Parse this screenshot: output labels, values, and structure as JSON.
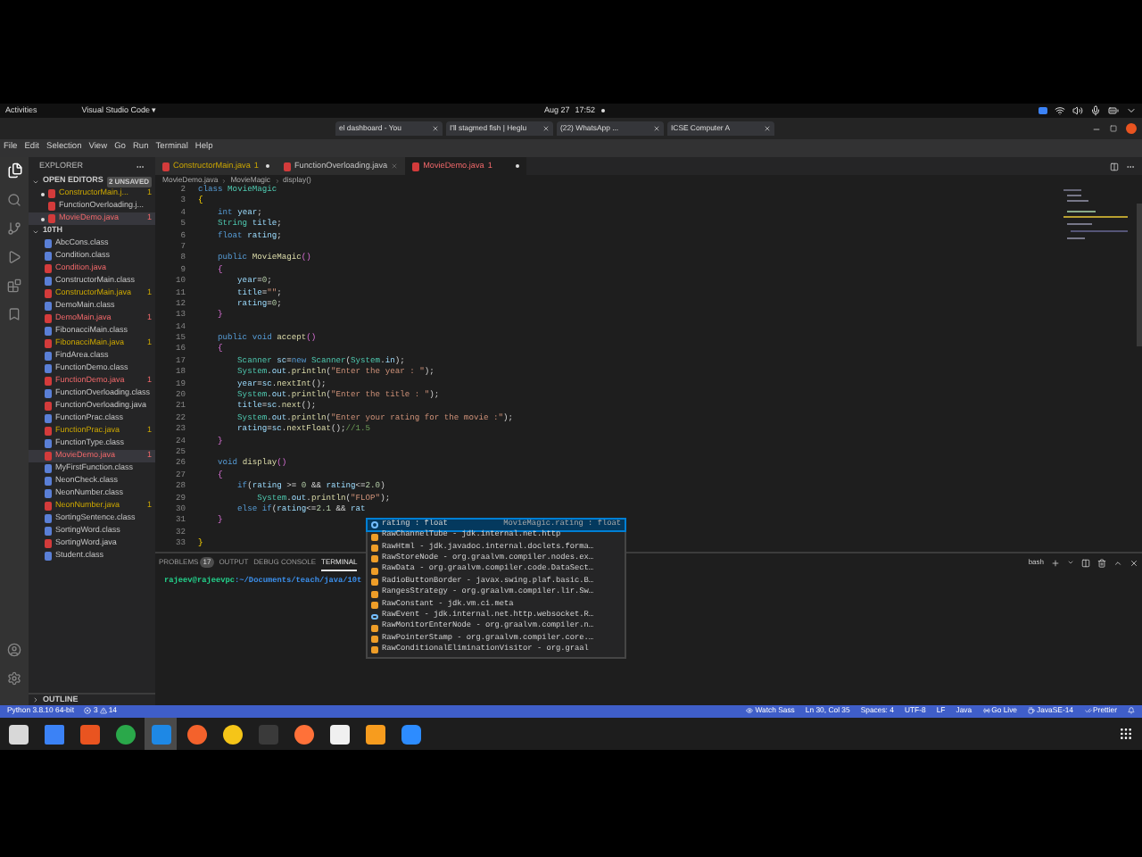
{
  "top_bar": {
    "activities": "Activities",
    "app_menu": "Visual Studio Code ▾",
    "date": "Aug 27",
    "time": "17:52"
  },
  "browser_tabs": [
    {
      "title": "el dashboard - You"
    },
    {
      "title": "I'll stagmed fish | Heglu"
    },
    {
      "title": "(22) WhatsApp ..."
    },
    {
      "title": "ICSE Computer A"
    }
  ],
  "menu": [
    "File",
    "Edit",
    "Selection",
    "View",
    "Go",
    "Run",
    "Terminal",
    "Help"
  ],
  "explorer": {
    "title": "EXPLORER",
    "open_editors": {
      "title": "OPEN EDITORS",
      "badge": "2 UNSAVED",
      "items": [
        {
          "name": "ConstructorMain.j...",
          "kind": "java",
          "warning": true,
          "error": false,
          "badge": "1",
          "modified": true,
          "selected": false
        },
        {
          "name": "FunctionOverloading.j...",
          "kind": "java",
          "warning": false,
          "error": false,
          "modified": false,
          "selected": false
        },
        {
          "name": "MovieDemo.java",
          "kind": "java",
          "warning": false,
          "error": true,
          "badge": "1",
          "modified": true,
          "selected": true
        }
      ]
    },
    "folder": {
      "name": "10TH",
      "expanded": true,
      "files": [
        {
          "name": "AbcCons.class",
          "kind": "class",
          "warning": false,
          "error": false,
          "selected": false
        },
        {
          "name": "Condition.class",
          "kind": "class",
          "warning": false,
          "error": false,
          "selected": false
        },
        {
          "name": "Condition.java",
          "kind": "java",
          "warning": false,
          "error": true,
          "selected": false
        },
        {
          "name": "ConstructorMain.class",
          "kind": "class",
          "warning": false,
          "error": false,
          "selected": false
        },
        {
          "name": "ConstructorMain.java",
          "kind": "java",
          "warning": true,
          "error": false,
          "badge": "1",
          "selected": false
        },
        {
          "name": "DemoMain.class",
          "kind": "class",
          "warning": false,
          "error": false,
          "selected": false
        },
        {
          "name": "DemoMain.java",
          "kind": "java",
          "warning": false,
          "error": true,
          "badge": "1",
          "selected": false
        },
        {
          "name": "FibonacciMain.class",
          "kind": "class",
          "warning": false,
          "error": false,
          "selected": false
        },
        {
          "name": "FibonacciMain.java",
          "kind": "java",
          "warning": true,
          "error": false,
          "badge": "1",
          "selected": false
        },
        {
          "name": "FindArea.class",
          "kind": "class",
          "warning": false,
          "error": false,
          "selected": false
        },
        {
          "name": "FunctionDemo.class",
          "kind": "class",
          "warning": false,
          "error": false,
          "selected": false
        },
        {
          "name": "FunctionDemo.java",
          "kind": "java",
          "warning": false,
          "error": true,
          "badge": "1",
          "selected": false
        },
        {
          "name": "FunctionOverloading.class",
          "kind": "class",
          "warning": false,
          "error": false,
          "selected": false
        },
        {
          "name": "FunctionOverloading.java",
          "kind": "java",
          "warning": false,
          "error": false,
          "selected": false
        },
        {
          "name": "FunctionPrac.class",
          "kind": "class",
          "warning": false,
          "error": false,
          "selected": false
        },
        {
          "name": "FunctionPrac.java",
          "kind": "java",
          "warning": true,
          "error": false,
          "badge": "1",
          "selected": false
        },
        {
          "name": "FunctionType.class",
          "kind": "class",
          "warning": false,
          "error": false,
          "selected": false
        },
        {
          "name": "MovieDemo.java",
          "kind": "java",
          "warning": false,
          "error": true,
          "badge": "1",
          "selected": true
        },
        {
          "name": "MyFirstFunction.class",
          "kind": "class",
          "warning": false,
          "error": false,
          "selected": false
        },
        {
          "name": "NeonCheck.class",
          "kind": "class",
          "warning": false,
          "error": false,
          "selected": false
        },
        {
          "name": "NeonNumber.class",
          "kind": "class",
          "warning": false,
          "error": false,
          "selected": false
        },
        {
          "name": "NeonNumber.java",
          "kind": "java",
          "warning": true,
          "error": false,
          "badge": "1",
          "selected": false
        },
        {
          "name": "SortingSentence.class",
          "kind": "class",
          "warning": false,
          "error": false,
          "selected": false
        },
        {
          "name": "SortingWord.class",
          "kind": "class",
          "warning": false,
          "error": false,
          "selected": false
        },
        {
          "name": "SortingWord.java",
          "kind": "java",
          "warning": false,
          "error": false,
          "selected": false
        },
        {
          "name": "Student.class",
          "kind": "class",
          "warning": false,
          "error": false,
          "selected": false
        }
      ]
    },
    "outline": {
      "title": "OUTLINE",
      "expanded": false
    }
  },
  "editor": {
    "tabs": [
      {
        "label": "ConstructorMain.java",
        "badge": "1",
        "warning": true,
        "error": false,
        "modified": true,
        "selected": false
      },
      {
        "label": "FunctionOverloading.java",
        "warning": false,
        "error": false,
        "modified": false,
        "selected": false
      },
      {
        "label": "MovieDemo.java",
        "badge": "1",
        "warning": false,
        "error": true,
        "modified": true,
        "selected": true
      }
    ],
    "breadcrumb": [
      "MovieDemo.java",
      "MovieMagic",
      "display()"
    ],
    "lines": [
      {
        "number": "2",
        "tokens": [
          {
            "text": "class",
            "kind": "kw"
          },
          {
            "text": " MovieMagic",
            "kind": "type"
          }
        ]
      },
      {
        "number": "3",
        "tokens": [
          {
            "text": "{",
            "kind": "brace"
          }
        ]
      },
      {
        "number": "4",
        "tokens": [
          {
            "text": "    int",
            "kind": "kw"
          },
          {
            "text": " year",
            "kind": "var"
          },
          {
            "text": ";",
            "kind": "p"
          }
        ]
      },
      {
        "number": "5",
        "tokens": [
          {
            "text": "    String",
            "kind": "type"
          },
          {
            "text": " title",
            "kind": "var"
          },
          {
            "text": ";",
            "kind": "p"
          }
        ]
      },
      {
        "number": "6",
        "tokens": [
          {
            "text": "    float",
            "kind": "kw"
          },
          {
            "text": " rating",
            "kind": "var"
          },
          {
            "text": ";",
            "kind": "p"
          }
        ]
      },
      {
        "number": "7"
      },
      {
        "number": "8",
        "tokens": [
          {
            "text": "    public",
            "kind": "kw"
          },
          {
            "text": " MovieMagic",
            "kind": "fn"
          },
          {
            "text": "()",
            "kind": "brace2"
          }
        ]
      },
      {
        "number": "9",
        "tokens": [
          {
            "text": "    {",
            "kind": "brace2"
          }
        ]
      },
      {
        "number": "10",
        "tokens": [
          {
            "text": "        year",
            "kind": "var"
          },
          {
            "text": "=",
            "kind": "p"
          },
          {
            "text": "0",
            "kind": "num"
          },
          {
            "text": ";",
            "kind": "p"
          }
        ]
      },
      {
        "number": "11",
        "tokens": [
          {
            "text": "        title",
            "kind": "var"
          },
          {
            "text": "=",
            "kind": "p"
          },
          {
            "text": "\"\"",
            "kind": "str"
          },
          {
            "text": ";",
            "kind": "p"
          }
        ]
      },
      {
        "number": "12",
        "tokens": [
          {
            "text": "        rating",
            "kind": "var"
          },
          {
            "text": "=",
            "kind": "p"
          },
          {
            "text": "0",
            "kind": "num"
          },
          {
            "text": ";",
            "kind": "p"
          }
        ]
      },
      {
        "number": "13",
        "tokens": [
          {
            "text": "    }",
            "kind": "brace2"
          }
        ]
      },
      {
        "number": "14"
      },
      {
        "number": "15",
        "tokens": [
          {
            "text": "    public void",
            "kind": "kw"
          },
          {
            "text": " accept",
            "kind": "fn"
          },
          {
            "text": "()",
            "kind": "brace2"
          }
        ]
      },
      {
        "number": "16",
        "tokens": [
          {
            "text": "    {",
            "kind": "brace2"
          }
        ]
      },
      {
        "number": "17",
        "tokens": [
          {
            "text": "        Scanner",
            "kind": "type"
          },
          {
            "text": " sc",
            "kind": "var"
          },
          {
            "text": "=",
            "kind": "p"
          },
          {
            "text": "new",
            "kind": "kw"
          },
          {
            "text": " Scanner",
            "kind": "type"
          },
          {
            "text": "(",
            "kind": "p"
          },
          {
            "text": "System",
            "kind": "type"
          },
          {
            "text": ".",
            "kind": "p"
          },
          {
            "text": "in",
            "kind": "var"
          },
          {
            "text": ");",
            "kind": "p"
          }
        ]
      },
      {
        "number": "18",
        "tokens": [
          {
            "text": "        System",
            "kind": "type"
          },
          {
            "text": ".",
            "kind": "p"
          },
          {
            "text": "out",
            "kind": "var"
          },
          {
            "text": ".",
            "kind": "p"
          },
          {
            "text": "println",
            "kind": "fn"
          },
          {
            "text": "(",
            "kind": "p"
          },
          {
            "text": "\"Enter the year : \"",
            "kind": "str"
          },
          {
            "text": ");",
            "kind": "p"
          }
        ]
      },
      {
        "number": "19",
        "tokens": [
          {
            "text": "        year",
            "kind": "var"
          },
          {
            "text": "=",
            "kind": "p"
          },
          {
            "text": "sc",
            "kind": "var"
          },
          {
            "text": ".",
            "kind": "p"
          },
          {
            "text": "nextInt",
            "kind": "fn"
          },
          {
            "text": "();",
            "kind": "p"
          }
        ]
      },
      {
        "number": "20",
        "tokens": [
          {
            "text": "        System",
            "kind": "type"
          },
          {
            "text": ".",
            "kind": "p"
          },
          {
            "text": "out",
            "kind": "var"
          },
          {
            "text": ".",
            "kind": "p"
          },
          {
            "text": "println",
            "kind": "fn"
          },
          {
            "text": "(",
            "kind": "p"
          },
          {
            "text": "\"Enter the title : \"",
            "kind": "str"
          },
          {
            "text": ");",
            "kind": "p"
          }
        ]
      },
      {
        "number": "21",
        "tokens": [
          {
            "text": "        title",
            "kind": "var"
          },
          {
            "text": "=",
            "kind": "p"
          },
          {
            "text": "sc",
            "kind": "var"
          },
          {
            "text": ".",
            "kind": "p"
          },
          {
            "text": "next",
            "kind": "fn"
          },
          {
            "text": "();",
            "kind": "p"
          }
        ]
      },
      {
        "number": "22",
        "tokens": [
          {
            "text": "        System",
            "kind": "type"
          },
          {
            "text": ".",
            "kind": "p"
          },
          {
            "text": "out",
            "kind": "var"
          },
          {
            "text": ".",
            "kind": "p"
          },
          {
            "text": "println",
            "kind": "fn"
          },
          {
            "text": "(",
            "kind": "p"
          },
          {
            "text": "\"Enter your rating for the movie :\"",
            "kind": "str"
          },
          {
            "text": ");",
            "kind": "p"
          }
        ]
      },
      {
        "number": "23",
        "tokens": [
          {
            "text": "        rating",
            "kind": "var"
          },
          {
            "text": "=",
            "kind": "p"
          },
          {
            "text": "sc",
            "kind": "var"
          },
          {
            "text": ".",
            "kind": "p"
          },
          {
            "text": "nextFloat",
            "kind": "fn"
          },
          {
            "text": "();",
            "kind": "p"
          },
          {
            "text": "//1.5",
            "kind": "cmt"
          }
        ]
      },
      {
        "number": "24",
        "tokens": [
          {
            "text": "    }",
            "kind": "brace2"
          }
        ]
      },
      {
        "number": "25"
      },
      {
        "number": "26",
        "tokens": [
          {
            "text": "    void",
            "kind": "kw"
          },
          {
            "text": " display",
            "kind": "fn"
          },
          {
            "text": "()",
            "kind": "brace2"
          }
        ]
      },
      {
        "number": "27",
        "tokens": [
          {
            "text": "    {",
            "kind": "brace2"
          }
        ]
      },
      {
        "number": "28",
        "tokens": [
          {
            "text": "        if",
            "kind": "kw"
          },
          {
            "text": "(",
            "kind": "p"
          },
          {
            "text": "rating",
            "kind": "var"
          },
          {
            "text": " >= ",
            "kind": "p"
          },
          {
            "text": "0",
            "kind": "num"
          },
          {
            "text": " && ",
            "kind": "p"
          },
          {
            "text": "rating",
            "kind": "var"
          },
          {
            "text": "<=",
            "kind": "p"
          },
          {
            "text": "2.0",
            "kind": "num"
          },
          {
            "text": ")",
            "kind": "p"
          }
        ]
      },
      {
        "number": "29",
        "tokens": [
          {
            "text": "            System",
            "kind": "type"
          },
          {
            "text": ".",
            "kind": "p"
          },
          {
            "text": "out",
            "kind": "var"
          },
          {
            "text": ".",
            "kind": "p"
          },
          {
            "text": "println",
            "kind": "fn"
          },
          {
            "text": "(",
            "kind": "p"
          },
          {
            "text": "\"FLOP\"",
            "kind": "str"
          },
          {
            "text": ");",
            "kind": "p"
          }
        ]
      },
      {
        "number": "30",
        "tokens": [
          {
            "text": "        else if",
            "kind": "kw"
          },
          {
            "text": "(",
            "kind": "p"
          },
          {
            "text": "rating",
            "kind": "var"
          },
          {
            "text": "<=",
            "kind": "p"
          },
          {
            "text": "2.1",
            "kind": "num"
          },
          {
            "text": " && ",
            "kind": "p"
          },
          {
            "text": "rat",
            "kind": "var"
          }
        ]
      },
      {
        "number": "31",
        "tokens": [
          {
            "text": "    }",
            "kind": "brace2"
          }
        ]
      },
      {
        "number": "32"
      },
      {
        "number": "33",
        "tokens": [
          {
            "text": "}",
            "kind": "brace"
          }
        ]
      }
    ]
  },
  "suggestions": [
    {
      "kind": "field",
      "label": "rating : float",
      "detail": "MovieMagic.rating : float",
      "selected": true
    },
    {
      "kind": "class",
      "label": "RawChannelTube - jdk.internal.net.http",
      "selected": false
    },
    {
      "kind": "class",
      "label": "RawHtml - jdk.javadoc.internal.doclets.forma…",
      "selected": false
    },
    {
      "kind": "class",
      "label": "RawStoreNode - org.graalvm.compiler.nodes.ex…",
      "selected": false
    },
    {
      "kind": "class",
      "label": "RawData - org.graalvm.compiler.code.DataSect…",
      "selected": false
    },
    {
      "kind": "class",
      "label": "RadioButtonBorder - javax.swing.plaf.basic.B…",
      "selected": false
    },
    {
      "kind": "class",
      "label": "RangesStrategy - org.graalvm.compiler.lir.Sw…",
      "selected": false
    },
    {
      "kind": "class",
      "label": "RawConstant - jdk.vm.ci.meta",
      "selected": false
    },
    {
      "kind": "interface",
      "label": "RawEvent - jdk.internal.net.http.websocket.R…",
      "selected": false
    },
    {
      "kind": "class",
      "label": "RawMonitorEnterNode - org.graalvm.compiler.n…",
      "selected": false
    },
    {
      "kind": "class",
      "label": "RawPointerStamp - org.graalvm.compiler.core.…",
      "selected": false
    },
    {
      "kind": "class",
      "label": "RawConditionalEliminationVisitor - org.graal",
      "selected": false
    }
  ],
  "panel": {
    "tabs": [
      {
        "label": "PROBLEMS",
        "badge": "17",
        "selected": false
      },
      {
        "label": "OUTPUT",
        "selected": false
      },
      {
        "label": "DEBUG CONSOLE",
        "selected": false
      },
      {
        "label": "TERMINAL",
        "selected": true
      }
    ],
    "shell": "bash",
    "prompt_user": "rajeev@rajeevpc",
    "prompt_path": ":~/Documents/teach/java/10t"
  },
  "status_bar": {
    "interpreter": "Python 3.8.10 64-bit",
    "errors": "3",
    "warnings": "14",
    "items": [
      {
        "kind": "watcher",
        "text": "Watch Sass"
      },
      {
        "kind": "plain",
        "text": "Ln 30, Col 35"
      },
      {
        "kind": "plain",
        "text": "Spaces: 4"
      },
      {
        "kind": "plain",
        "text": "UTF-8"
      },
      {
        "kind": "plain",
        "text": "LF"
      },
      {
        "kind": "plain",
        "text": "Java"
      },
      {
        "kind": "live",
        "text": "Go Live"
      },
      {
        "kind": "runtime",
        "text": "JavaSE-14"
      },
      {
        "kind": "formatter",
        "text": "Prettier"
      }
    ]
  },
  "dock": [
    {
      "kind": "files",
      "selected": false
    },
    {
      "kind": "document",
      "selected": false
    },
    {
      "kind": "store",
      "selected": false
    },
    {
      "kind": "green",
      "selected": false
    },
    {
      "kind": "code",
      "selected": true
    },
    {
      "kind": "compass",
      "selected": false
    },
    {
      "kind": "browser",
      "selected": false
    },
    {
      "kind": "terminal",
      "selected": false
    },
    {
      "kind": "fox",
      "selected": false
    },
    {
      "kind": "notes",
      "selected": false
    },
    {
      "kind": "sync",
      "selected": false
    },
    {
      "kind": "video",
      "selected": false
    }
  ]
}
